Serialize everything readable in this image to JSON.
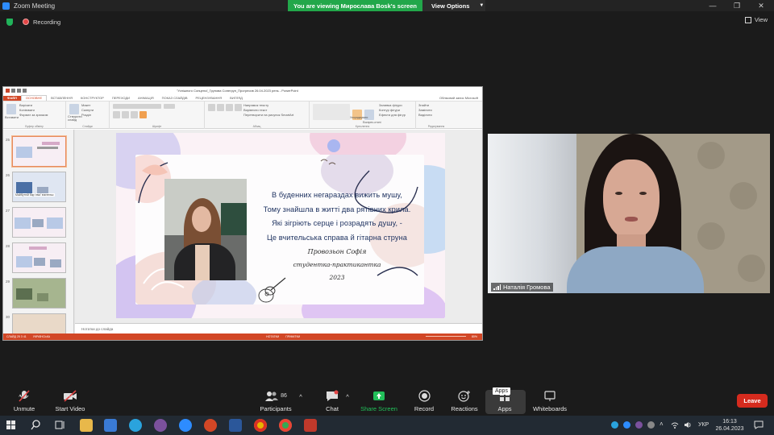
{
  "window": {
    "title": "Zoom Meeting",
    "share_banner": "You are viewing Мирослава Bosk's screen",
    "view_options": "View Options"
  },
  "status": {
    "recording": "Recording",
    "view": "View"
  },
  "ppt": {
    "doc_title": "\"Успішного Сонценої_Групова Сонегруп_Прогресив 26.04.2023 рень - PowerPoint",
    "tabs": [
      "ФАЙЛ",
      "ОСНОВНЕ",
      "ВСТАВЛЕННЯ",
      "КОНСТРУКТОР",
      "ПЕРЕХОДИ",
      "АНІМАЦІЯ",
      "ПОКАЗ СЛАЙДІВ",
      "РЕЦЕНЗУВАННЯ",
      "ВИГЛЯД"
    ],
    "account": "Обліковий запис Microsoft",
    "ribbon": {
      "paste": "Вставити",
      "clip_items": [
        "Вирізати",
        "Копіювати",
        "Формат за зразком"
      ],
      "clip_group": "Буфер обміну",
      "new_slide": "Створити слайд",
      "slide_items": [
        "Макет",
        "Скинути",
        "Розділ"
      ],
      "slides_group": "Слайди",
      "font_group": "Шрифт",
      "para_items": [
        "Напрямок тексту",
        "Вирівняти текст",
        "Перетворити на рисунок SmartArt"
      ],
      "para_group": "Абзац",
      "arrange": "Упорядкувати",
      "quick_styles": "Експрес-стилі",
      "shape_items": [
        "Заливка фігури",
        "Контур фігури",
        "Ефекти для фігур"
      ],
      "drawing_group": "Креслення",
      "edit_items": [
        "Знайти",
        "Замінити",
        "Виділити"
      ],
      "edit_group": "Редагування"
    },
    "thumbnails": [
      {
        "num": "25",
        "caption": ""
      },
      {
        "num": "26",
        "caption": "Майбутній бар 'ємо' вчительс"
      },
      {
        "num": "27",
        "caption": ""
      },
      {
        "num": "28",
        "caption": ""
      },
      {
        "num": "29",
        "caption": ""
      },
      {
        "num": "30",
        "caption": ""
      }
    ],
    "notes": "Нотатки до слайда",
    "status_left": "СЛАЙД 25 З 41",
    "status_lang": "УКРАЇНСЬКА",
    "status_notes": "НОТАТКИ",
    "status_comments": "ПРИМІТКИ",
    "zoom": "80%"
  },
  "slide": {
    "poem": [
      "В буденних негараздах  вижить мушу,",
      "Тому знайшла в житті  два рятівних крила.",
      "Які зігріють серце і розрадять душу, -",
      "Це вчительська справа й гітарна струна"
    ],
    "author": "Провозьон Софія",
    "role": "студентка-практикантка",
    "year": "2023"
  },
  "participant": {
    "name": "Наталія Громова"
  },
  "toolbar": {
    "unmute": "Unmute",
    "start_video": "Start Video",
    "participants": "Participants",
    "participants_count": "86",
    "chat": "Chat",
    "share_screen": "Share Screen",
    "record": "Record",
    "reactions": "Reactions",
    "apps": "Apps",
    "apps_tooltip": "Apps",
    "whiteboards": "Whiteboards",
    "leave": "Leave"
  },
  "taskbar": {
    "lang": "УКР",
    "time": "16:13",
    "date": "26.04.2023"
  },
  "colors": {
    "share_green": "#22a74a",
    "leave_red": "#d52b1e",
    "ppt_accent": "#d24726",
    "zoom_blue": "#2d8cff"
  }
}
